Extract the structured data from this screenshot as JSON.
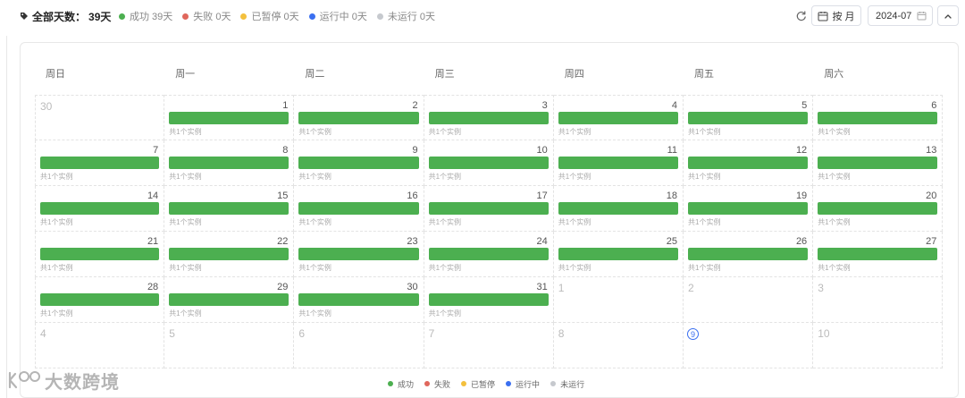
{
  "summary": {
    "total_label": "全部天数：",
    "total_value": "39天",
    "statuses": [
      {
        "label": "成功 39天",
        "color": "#4caf50"
      },
      {
        "label": "失败 0天",
        "color": "#e0675c"
      },
      {
        "label": "已暂停 0天",
        "color": "#f3c03d"
      },
      {
        "label": "运行中 0天",
        "color": "#3a6ff0"
      },
      {
        "label": "未运行 0天",
        "color": "#c6c9ce"
      }
    ]
  },
  "toolbar": {
    "view_label": "按 月",
    "date_value": "2024-07"
  },
  "calendar": {
    "weekdays": [
      "周日",
      "周一",
      "周二",
      "周三",
      "周四",
      "周五",
      "周六"
    ],
    "instance_label": "共1个实例",
    "success_color": "#4caf50",
    "weeks": [
      [
        {
          "d": "30",
          "o": true
        },
        {
          "d": "1"
        },
        {
          "d": "2"
        },
        {
          "d": "3"
        },
        {
          "d": "4"
        },
        {
          "d": "5"
        },
        {
          "d": "6"
        }
      ],
      [
        {
          "d": "7"
        },
        {
          "d": "8"
        },
        {
          "d": "9"
        },
        {
          "d": "10"
        },
        {
          "d": "11"
        },
        {
          "d": "12"
        },
        {
          "d": "13"
        }
      ],
      [
        {
          "d": "14"
        },
        {
          "d": "15"
        },
        {
          "d": "16"
        },
        {
          "d": "17"
        },
        {
          "d": "18"
        },
        {
          "d": "19"
        },
        {
          "d": "20"
        }
      ],
      [
        {
          "d": "21"
        },
        {
          "d": "22"
        },
        {
          "d": "23"
        },
        {
          "d": "24"
        },
        {
          "d": "25"
        },
        {
          "d": "26"
        },
        {
          "d": "27"
        }
      ],
      [
        {
          "d": "28"
        },
        {
          "d": "29"
        },
        {
          "d": "30"
        },
        {
          "d": "31"
        },
        {
          "d": "1",
          "o": true
        },
        {
          "d": "2",
          "o": true
        },
        {
          "d": "3",
          "o": true
        }
      ],
      [
        {
          "d": "4",
          "o": true
        },
        {
          "d": "5",
          "o": true
        },
        {
          "d": "6",
          "o": true
        },
        {
          "d": "7",
          "o": true
        },
        {
          "d": "8",
          "o": true
        },
        {
          "d": "9",
          "o": true,
          "today": true
        },
        {
          "d": "10",
          "o": true
        }
      ]
    ]
  },
  "legend": [
    {
      "label": "成功",
      "color": "#4caf50"
    },
    {
      "label": "失败",
      "color": "#e0675c"
    },
    {
      "label": "已暂停",
      "color": "#f3c03d"
    },
    {
      "label": "运行中",
      "color": "#3a6ff0"
    },
    {
      "label": "未运行",
      "color": "#c6c9ce"
    }
  ],
  "watermark": "大数跨境"
}
